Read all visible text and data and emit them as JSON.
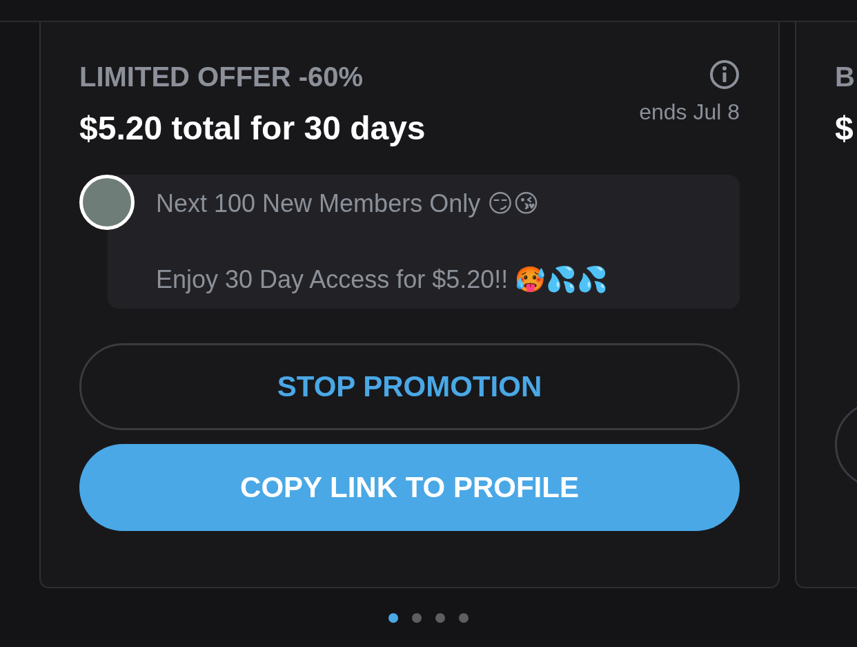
{
  "cards": [
    {
      "title": "LIMITED OFFER -60%",
      "ends": "ends Jul 8",
      "price": "$5.20 total for 30 days",
      "message": [
        "Next 100 New Members Only 😏😘",
        "Enjoy 30 Day Access for $5.20!! 🥵💦💦"
      ],
      "buttons": [
        {
          "label": "STOP PROMOTION",
          "kind": "outline"
        },
        {
          "label": "COPY LINK TO PROFILE",
          "kind": "filled"
        }
      ]
    },
    {
      "title": "B",
      "price": "$",
      "buttons": [
        {
          "kind": "outline"
        }
      ]
    }
  ],
  "pager": [
    {
      "selected": true
    },
    {
      "selected": false
    },
    {
      "selected": false
    },
    {
      "selected": false
    }
  ]
}
